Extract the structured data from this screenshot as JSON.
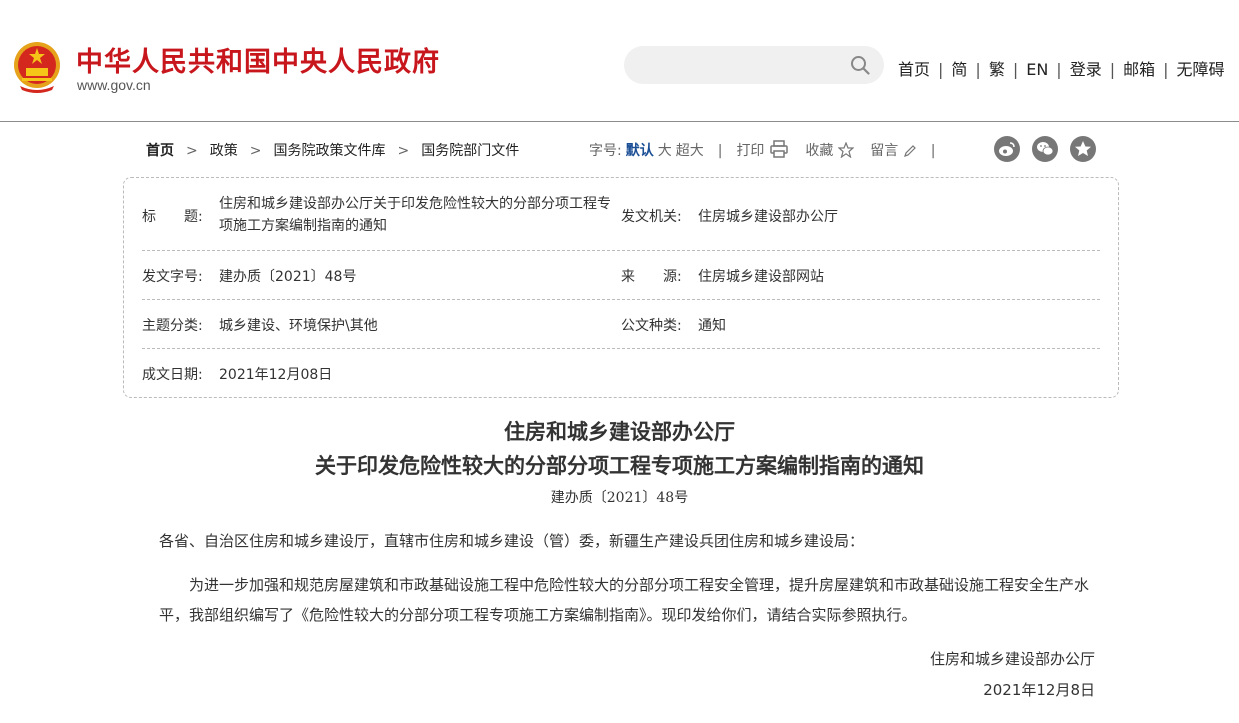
{
  "header": {
    "site_title": "中华人民共和国中央人民政府",
    "site_url": "www.gov.cn",
    "search_placeholder": "",
    "nav": [
      "首页",
      "简",
      "繁",
      "EN",
      "登录",
      "邮箱",
      "无障碍"
    ],
    "brand_color": "#c8161d"
  },
  "breadcrumb": {
    "home": "首页",
    "items": [
      "政策",
      "国务院政策文件库",
      "国务院部门文件"
    ]
  },
  "toolbar": {
    "font_label": "字号:",
    "font_default": "默认",
    "font_large": "大",
    "font_xlarge": "超大",
    "print_label": "打印",
    "favorite_label": "收藏",
    "comment_label": "留言",
    "icons": [
      "weibo-icon",
      "wechat-icon",
      "favorite-star-icon"
    ]
  },
  "meta": {
    "title_label": "标　　题:",
    "title_value_line1": "住房和城乡建设部办公厅关于印发危险性较大的分部分项工程专",
    "title_value_line2": "项施工方案编制指南的通知",
    "issuer_label": "发文机关:",
    "issuer_value": "住房城乡建设部办公厅",
    "doc_no_label": "发文字号:",
    "doc_no_value": "建办质〔2021〕48号",
    "source_label": "来　　源:",
    "source_value": "住房城乡建设部网站",
    "topic_label": "主题分类:",
    "topic_value": "城乡建设、环境保护\\其他",
    "genre_label": "公文种类:",
    "genre_value": "通知",
    "date_label": "成文日期:",
    "date_value": "2021年12月08日"
  },
  "document": {
    "title_line1": "住房和城乡建设部办公厅",
    "title_line2": "关于印发危险性较大的分部分项工程专项施工方案编制指南的通知",
    "doc_number": "建办质〔2021〕48号",
    "salutation": "各省、自治区住房和城乡建设厅，直辖市住房和城乡建设（管）委，新疆生产建设兵团住房和城乡建设局：",
    "body": "为进一步加强和规范房屋建筑和市政基础设施工程中危险性较大的分部分项工程安全管理，提升房屋建筑和市政基础设施工程安全生产水平，我部组织编写了《危险性较大的分部分项工程专项施工方案编制指南》。现印发给你们，请结合实际参照执行。",
    "signature": "住房和城乡建设部办公厅",
    "date": "2021年12月8日"
  }
}
